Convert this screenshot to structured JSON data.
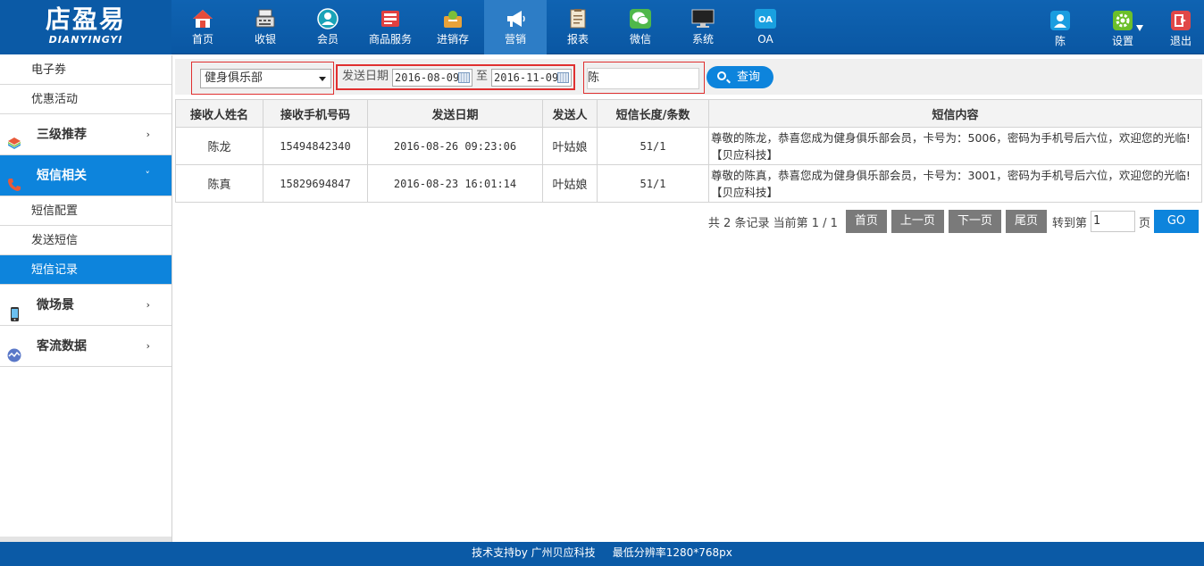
{
  "logo": {
    "cn": "店盈易",
    "en": "DIANYINGYI"
  },
  "nav": [
    {
      "label": "首页",
      "icon": "home-icon",
      "color": "#e54b3c"
    },
    {
      "label": "收银",
      "icon": "cash-register-icon",
      "color": "#555555"
    },
    {
      "label": "会员",
      "icon": "member-icon",
      "color": "#1aa3b8"
    },
    {
      "label": "商品服务",
      "icon": "goods-icon",
      "color": "#e04040"
    },
    {
      "label": "进销存",
      "icon": "inventory-icon",
      "color": "#e8a23a"
    },
    {
      "label": "营销",
      "icon": "megaphone-icon",
      "color": "#ffffff"
    },
    {
      "label": "报表",
      "icon": "report-icon",
      "color": "#8a6d4a"
    },
    {
      "label": "微信",
      "icon": "wechat-icon",
      "color": "#4fb84a"
    },
    {
      "label": "系统",
      "icon": "monitor-icon",
      "color": "#333333"
    },
    {
      "label": "OA",
      "icon": "oa-icon",
      "color": "#19a0e0"
    }
  ],
  "user": {
    "name": "陈"
  },
  "settings_label": "设置",
  "logout_label": "退出",
  "sidebar": {
    "top_subs": [
      "电子券",
      "优惠活动"
    ],
    "sections": [
      {
        "label": "三级推荐",
        "chev": "›"
      },
      {
        "label": "短信相关",
        "chev": "˅"
      },
      {
        "label": "微场景",
        "chev": "›"
      },
      {
        "label": "客流数据",
        "chev": "›"
      }
    ],
    "sms_subs": [
      "短信配置",
      "发送短信",
      "短信记录"
    ]
  },
  "filter": {
    "store": "健身俱乐部",
    "date_label": "发送日期",
    "date_from": "2016-08-09",
    "to_label": "至",
    "date_to": "2016-11-09",
    "name_value": "陈",
    "search_label": "查询"
  },
  "table": {
    "headers": [
      "接收人姓名",
      "接收手机号码",
      "发送日期",
      "发送人",
      "短信长度/条数",
      "短信内容"
    ],
    "rows": [
      [
        "陈龙",
        "15494842340",
        "2016-08-26 09:23:06",
        "叶姑娘",
        "51/1",
        "尊敬的陈龙，恭喜您成为健身俱乐部会员，卡号为：5006，密码为手机号后六位，欢迎您的光临!【贝应科技】"
      ],
      [
        "陈真",
        "15829694847",
        "2016-08-23 16:01:14",
        "叶姑娘",
        "51/1",
        "尊敬的陈真，恭喜您成为健身俱乐部会员，卡号为：3001，密码为手机号后六位，欢迎您的光临!【贝应科技】"
      ]
    ]
  },
  "pager": {
    "summary": "共 2 条记录 当前第 1 / 1",
    "first": "首页",
    "prev": "上一页",
    "next": "下一页",
    "last": "尾页",
    "goto_label": "转到第",
    "goto_value": "1",
    "page_label": "页",
    "go": "GO"
  },
  "footer": {
    "text": "技术支持by 广州贝应科技     最低分辨率1280*768px"
  }
}
